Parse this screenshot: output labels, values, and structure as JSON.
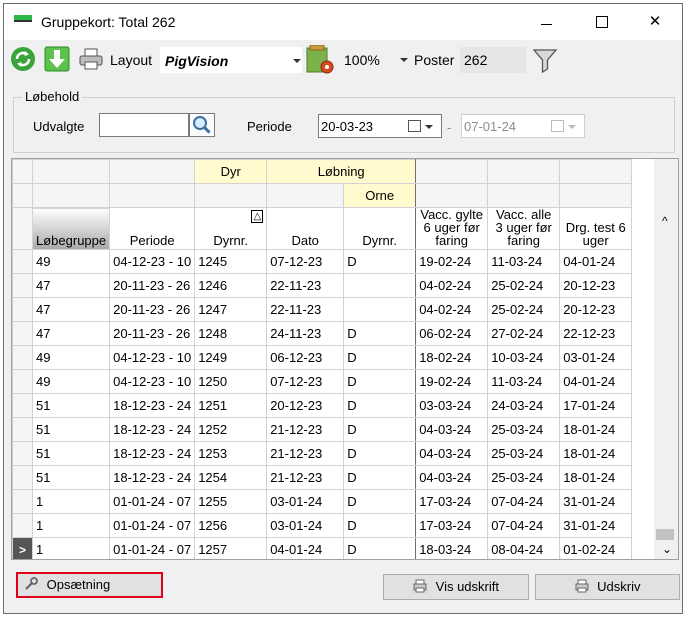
{
  "window": {
    "title": "Gruppekort: Total 262",
    "minimize_glyph": "",
    "maximize_glyph": "",
    "close_glyph": "✕"
  },
  "toolbar": {
    "icons": [
      "refresh-icon",
      "download-icon",
      "print-icon",
      "layout-settings-icon",
      "filter-icon"
    ],
    "layout_label": "Layout",
    "layout_value": "PigVision",
    "zoom_value": "100%",
    "poster_label": "Poster",
    "poster_value": "262"
  },
  "filter": {
    "group_title": "Løbehold",
    "udvalgte_label": "Udvalgte",
    "udvalgte_value": "",
    "periode_label": "Periode",
    "periode_from": "20-03-23",
    "periode_dash": "-",
    "periode_to": "07-01-24"
  },
  "grid": {
    "band1": {
      "dyr": "Dyr",
      "lobning": "Løbning"
    },
    "band2": {
      "orne": "Orne"
    },
    "columns": [
      "Løbegruppe",
      "Periode",
      "Dyrnr.",
      "Dato",
      "Dyrnr.",
      "Vacc. gylte 6 uger før faring",
      "Vacc. alle 3 uger før faring",
      "Drg. test 6 uger"
    ],
    "sort_indicator": "△",
    "current_row_marker": ">",
    "rows": [
      [
        "49",
        "04-12-23 - 10",
        "1245",
        "07-12-23",
        "D",
        "19-02-24",
        "11-03-24",
        "04-01-24"
      ],
      [
        "47",
        "20-11-23 - 26",
        "1246",
        "22-11-23",
        "",
        "04-02-24",
        "25-02-24",
        "20-12-23"
      ],
      [
        "47",
        "20-11-23 - 26",
        "1247",
        "22-11-23",
        "",
        "04-02-24",
        "25-02-24",
        "20-12-23"
      ],
      [
        "47",
        "20-11-23 - 26",
        "1248",
        "24-11-23",
        "D",
        "06-02-24",
        "27-02-24",
        "22-12-23"
      ],
      [
        "49",
        "04-12-23 - 10",
        "1249",
        "06-12-23",
        "D",
        "18-02-24",
        "10-03-24",
        "03-01-24"
      ],
      [
        "49",
        "04-12-23 - 10",
        "1250",
        "07-12-23",
        "D",
        "19-02-24",
        "11-03-24",
        "04-01-24"
      ],
      [
        "51",
        "18-12-23 - 24",
        "1251",
        "20-12-23",
        "D",
        "03-03-24",
        "24-03-24",
        "17-01-24"
      ],
      [
        "51",
        "18-12-23 - 24",
        "1252",
        "21-12-23",
        "D",
        "04-03-24",
        "25-03-24",
        "18-01-24"
      ],
      [
        "51",
        "18-12-23 - 24",
        "1253",
        "21-12-23",
        "D",
        "04-03-24",
        "25-03-24",
        "18-01-24"
      ],
      [
        "51",
        "18-12-23 - 24",
        "1254",
        "21-12-23",
        "D",
        "04-03-24",
        "25-03-24",
        "18-01-24"
      ],
      [
        "1",
        "01-01-24 - 07",
        "1255",
        "03-01-24",
        "D",
        "17-03-24",
        "07-04-24",
        "31-01-24"
      ],
      [
        "1",
        "01-01-24 - 07",
        "1256",
        "03-01-24",
        "D",
        "17-03-24",
        "07-04-24",
        "31-01-24"
      ],
      [
        "1",
        "01-01-24 - 07",
        "1257",
        "04-01-24",
        "D",
        "18-03-24",
        "08-04-24",
        "01-02-24"
      ]
    ],
    "scroll_up": "^",
    "scroll_down": "⌄"
  },
  "footer": {
    "opsaetning_label": "Opsætning",
    "vis_udskrift_label": "Vis udskrift",
    "udskriv_label": "Udskriv"
  }
}
